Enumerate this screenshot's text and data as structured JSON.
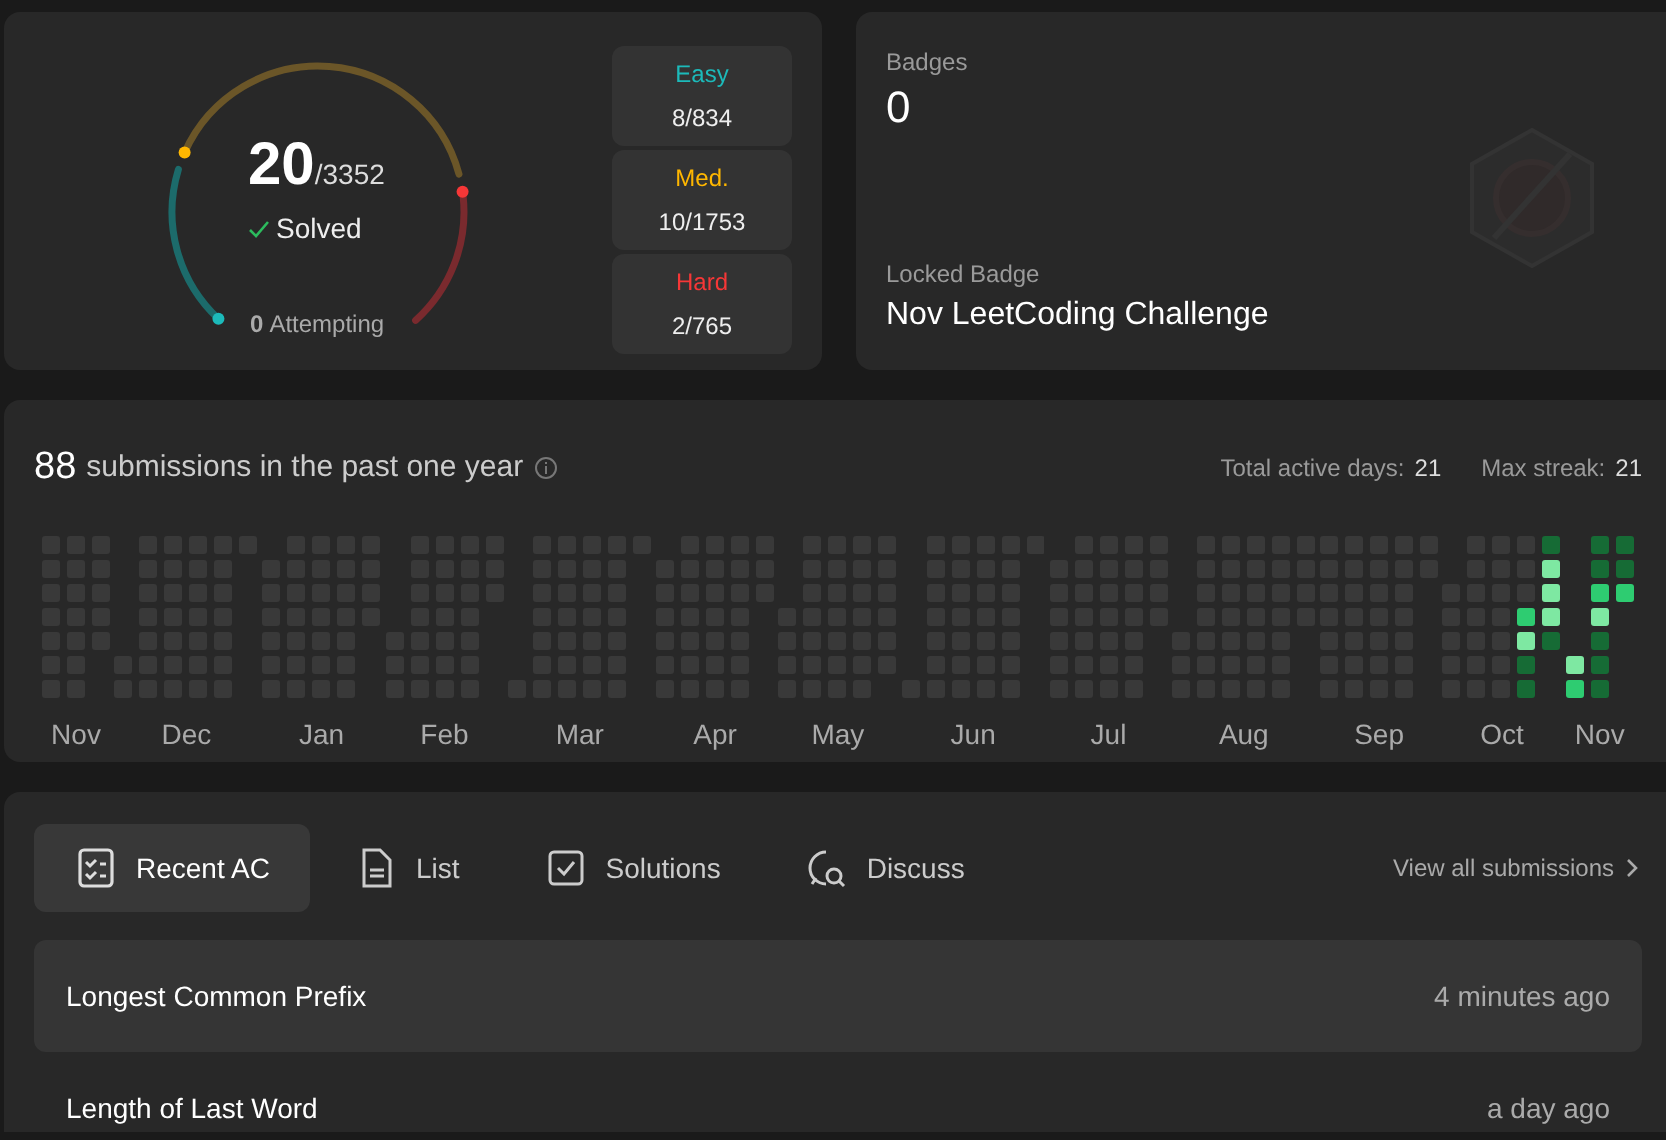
{
  "solved": {
    "count": "20",
    "total": "/3352",
    "label": "Solved",
    "attempting_count": "0",
    "attempting_label": "Attempting"
  },
  "difficulties": [
    {
      "kind": "easy",
      "label": "Easy",
      "value": "8/834"
    },
    {
      "kind": "medium",
      "label": "Med.",
      "value": "10/1753"
    },
    {
      "kind": "hard",
      "label": "Hard",
      "value": "2/765"
    }
  ],
  "badges": {
    "title": "Badges",
    "count": "0",
    "locked_label": "Locked Badge",
    "locked_name": "Nov LeetCoding Challenge"
  },
  "submissions": {
    "count": "88",
    "text": "submissions in the past one year",
    "stats": [
      {
        "label": "Total active days:",
        "value": "21"
      },
      {
        "label": "Max streak:",
        "value": "21"
      }
    ],
    "months": [
      "Nov",
      "Dec",
      "Jan",
      "Feb",
      "Mar",
      "Apr",
      "May",
      "Jun",
      "Jul",
      "Aug",
      "Sep",
      "Oct",
      "Nov"
    ]
  },
  "tabs": [
    {
      "kind": "recent",
      "label": "Recent AC",
      "selected": true
    },
    {
      "kind": "list",
      "label": "List",
      "selected": false
    },
    {
      "kind": "solutions",
      "label": "Solutions",
      "selected": false
    },
    {
      "kind": "discuss",
      "label": "Discuss",
      "selected": false
    }
  ],
  "view_all": "View all submissions",
  "recent": [
    {
      "title": "Longest Common Prefix",
      "time": "4 minutes ago"
    },
    {
      "title": "Length of Last Word",
      "time": "a day ago"
    }
  ]
}
